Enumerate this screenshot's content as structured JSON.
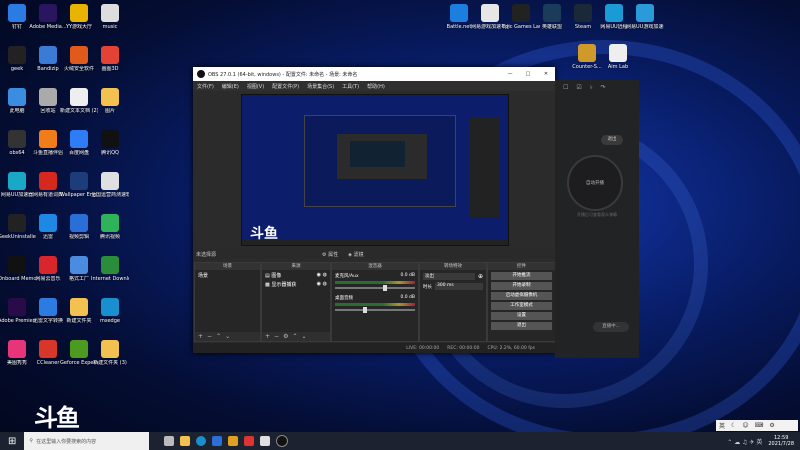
{
  "desktop": {
    "left_icons": [
      {
        "label": "钉钉",
        "color": "#2a7be4"
      },
      {
        "label": "Adobe Media...",
        "color": "#2a1560"
      },
      {
        "label": "YY游戏大厅",
        "color": "#e8b400"
      },
      {
        "label": "music",
        "color": "#ddd"
      },
      {
        "label": "geek",
        "color": "#222"
      },
      {
        "label": "Bandizip",
        "color": "#3a7bd5"
      },
      {
        "label": "火绒安全软件",
        "color": "#e05a1c"
      },
      {
        "label": "画图3D",
        "color": "#e34234"
      },
      {
        "label": "此电脑",
        "color": "#3a8de0"
      },
      {
        "label": "回收站",
        "color": "#aaa"
      },
      {
        "label": "新建文本文档 (2)",
        "color": "#eee"
      },
      {
        "label": "图片",
        "color": "#f3c14f"
      },
      {
        "label": "obs64",
        "color": "#333"
      },
      {
        "label": "斗鱼直播伴侣",
        "color": "#f07d1a"
      },
      {
        "label": "百度网盘",
        "color": "#2f7df6"
      },
      {
        "label": "腾讯QQ",
        "color": "#111"
      },
      {
        "label": "网易UU加速器",
        "color": "#1aa8c7"
      },
      {
        "label": "网易有道词典",
        "color": "#d6281f"
      },
      {
        "label": "Wallpaper Engine:...",
        "color": "#1d3d7a"
      },
      {
        "label": "全国运营商测速软件",
        "color": "#e0e0e0"
      },
      {
        "label": "GeekUninstaller",
        "color": "#222"
      },
      {
        "label": "迅雷",
        "color": "#1e88e5"
      },
      {
        "label": "视频剪辑",
        "color": "#2a6fd8"
      },
      {
        "label": "腾讯视频",
        "color": "#2fb35a"
      },
      {
        "label": "Onboard Memory...",
        "color": "#111"
      },
      {
        "label": "网易云音乐",
        "color": "#d8262c"
      },
      {
        "label": "格式工厂",
        "color": "#4a8de0"
      },
      {
        "label": "Internet Downlo...",
        "color": "#2a8d3a"
      },
      {
        "label": "Adobe Premiere ...",
        "color": "#2a0b4a"
      },
      {
        "label": "迅雷文字转换",
        "color": "#2b7be0"
      },
      {
        "label": "新建文件夹",
        "color": "#f3c14f"
      },
      {
        "label": "msedge",
        "color": "#1a8fd0"
      },
      {
        "label": "美图秀秀",
        "color": "#e8357a"
      },
      {
        "label": "CCleaner",
        "color": "#d9362a"
      },
      {
        "label": "Geforce Experience",
        "color": "#4c9a1f"
      },
      {
        "label": "新建文件夹 (3)",
        "color": "#f3c14f"
      }
    ],
    "right_icons": [
      {
        "label": "Battle.net",
        "color": "#1c7fe0"
      },
      {
        "label": "网易游戏加速平台",
        "color": "#e6e6e6"
      },
      {
        "label": "Epic Games Launcher",
        "color": "#222"
      },
      {
        "label": "英雄联盟",
        "color": "#1a3b5a"
      },
      {
        "label": "Steam",
        "color": "#1b2838"
      },
      {
        "label": "网易UU远程",
        "color": "#1a9bd6"
      },
      {
        "label": "网易UU游戏加速器",
        "color": "#2a9bd8"
      },
      {
        "label": "Counter-S...",
        "color": "#d09a2a"
      },
      {
        "label": "Aim Lab",
        "color": "#eee"
      }
    ],
    "watermark": "斗鱼"
  },
  "obs": {
    "title": "OBS 27.0.1 (64-bit, windows) - 配置文件: 未命名 - 场景: 未命名",
    "menu": [
      "文件(F)",
      "编辑(E)",
      "视图(V)",
      "配置文件(P)",
      "场景集合(S)",
      "工具(T)",
      "帮助(H)"
    ],
    "no_source_selected": "未选择源",
    "props_label": "属性",
    "filter_label": "滤镜",
    "docks": {
      "scenes": {
        "title": "场景",
        "items": [
          "场景"
        ]
      },
      "sources": {
        "title": "来源",
        "items": [
          "图像",
          "显示器捕获"
        ]
      },
      "mixer": {
        "title": "混音器",
        "channels": [
          {
            "name": "麦克风/Aux",
            "db": "0.0 dB",
            "level": 0.6
          },
          {
            "name": "桌面音频",
            "db": "0.0 dB",
            "level": 0.35
          }
        ]
      },
      "transitions": {
        "title": "转场特效",
        "type": "淡出",
        "duration_label": "时长",
        "duration_value": "300 ms"
      },
      "controls": {
        "title": "控件",
        "buttons": [
          "开始推流",
          "开始录制",
          "启动虚拟摄像机",
          "工作室模式",
          "设置",
          "退出"
        ]
      }
    },
    "status": {
      "live": "LIVE: 00:00:00",
      "rec": "REC: 00:00:00",
      "cpu": "CPU: 2.2%, 60.00 fps"
    }
  },
  "side_panel": {
    "button_top": "退出",
    "circle_label": "自动开播",
    "hint": "开播后可查看观众弹幕",
    "bottom_btn": "直播中..."
  },
  "taskbar": {
    "search_placeholder": "在这里输入你要搜索的内容",
    "tray_lang": "英",
    "time": "12:59",
    "date": "2021/7/28"
  },
  "colors": {
    "accent": "#3a7bd5",
    "obs_bg": "#2b2b2b",
    "desktop": "#0e2a8a"
  }
}
